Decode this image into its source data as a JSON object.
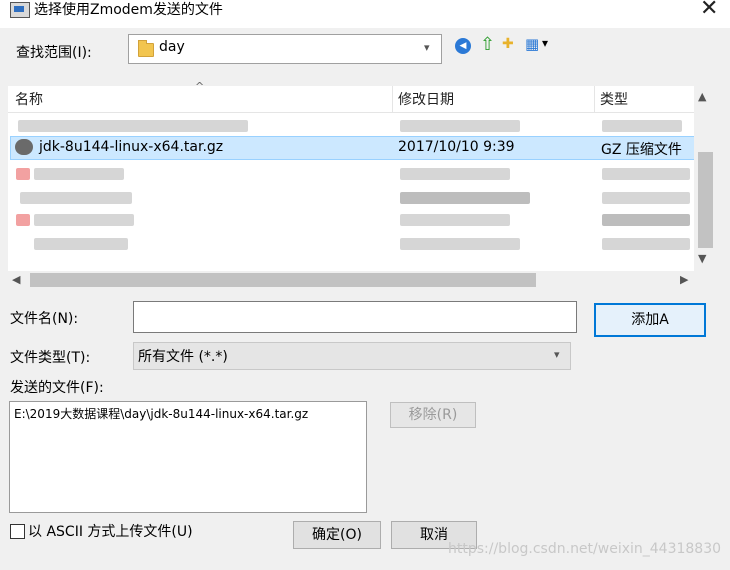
{
  "window": {
    "title": "选择使用Zmodem发送的文件",
    "close_glyph": "✕"
  },
  "look_in": {
    "label": "查找范围(I):",
    "value": "day"
  },
  "toolbar": {
    "back_glyph": "◀",
    "up_glyph": "⇧",
    "newfolder_glyph": "✚",
    "view_glyph": "▦",
    "view_dropdown": "▾"
  },
  "columns": [
    "名称",
    "修改日期",
    "类型"
  ],
  "selected_file": {
    "name": "jdk-8u144-linux-x64.tar.gz",
    "modified": "2017/10/10 9:39",
    "type": "GZ 压缩文件"
  },
  "filename": {
    "label": "文件名(N):",
    "value": ""
  },
  "filetype": {
    "label": "文件类型(T):",
    "value": "所有文件 (*.*)"
  },
  "add_button": "添加A",
  "send_files": {
    "label": "发送的文件(F):",
    "items": [
      "E:\\2019大数据课程\\day\\jdk-8u144-linux-x64.tar.gz"
    ]
  },
  "remove_button": "移除(R)",
  "ascii_checkbox": {
    "label": "以 ASCII 方式上传文件(U)",
    "checked": false
  },
  "ok_button": "确定(O)",
  "cancel_button": "取消",
  "watermark": "https://blog.csdn.net/weixin_44318830",
  "colors": {
    "selection": "#cce8ff",
    "accent": "#0078d7"
  }
}
